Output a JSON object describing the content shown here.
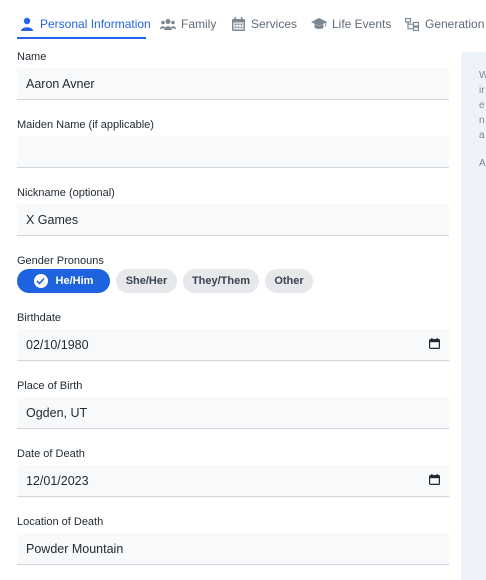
{
  "colors": {
    "accent": "#2563eb",
    "pill_selected": "#1d63e0",
    "input_bg": "#f8f9fb",
    "side_panel_bg": "#eef3fb"
  },
  "tabs": [
    {
      "label": "Personal Information",
      "icon": "person-icon",
      "active": true
    },
    {
      "label": "Family",
      "icon": "people-icon",
      "active": false
    },
    {
      "label": "Services",
      "icon": "calendar-icon",
      "active": false
    },
    {
      "label": "Life Events",
      "icon": "graduation-cap-icon",
      "active": false
    },
    {
      "label": "Generation",
      "icon": "tree-icon",
      "active": false
    }
  ],
  "side_panel": {
    "fragments": [
      "W",
      "ir",
      "e",
      "n",
      "a",
      "A"
    ]
  },
  "form": {
    "name": {
      "label": "Name",
      "value": "Aaron Avner"
    },
    "maiden_name": {
      "label": "Maiden Name (if applicable)",
      "value": ""
    },
    "nickname": {
      "label": "Nickname (optional)",
      "value": "X Games"
    },
    "gender_pronouns": {
      "label": "Gender Pronouns",
      "options": [
        "He/Him",
        "She/Her",
        "They/Them",
        "Other"
      ],
      "selected": "He/Him"
    },
    "birthdate": {
      "label": "Birthdate",
      "value": "02/10/1980"
    },
    "place_of_birth": {
      "label": "Place of Birth",
      "value": "Ogden, UT"
    },
    "date_of_death": {
      "label": "Date of Death",
      "value": "12/01/2023"
    },
    "location_of_death": {
      "label": "Location of Death",
      "value": "Powder Mountain"
    }
  }
}
